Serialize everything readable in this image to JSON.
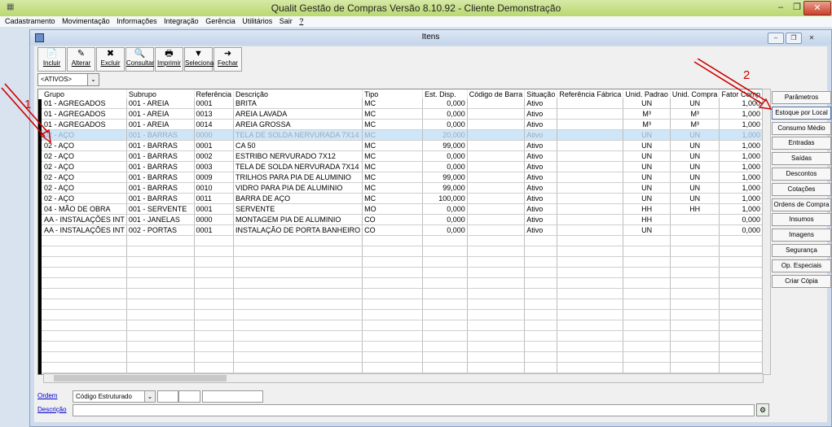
{
  "app_title": "Qualit Gestão de Compras Versão 8.10.92 - Cliente Demonstração",
  "window_buttons": {
    "minimize": "–",
    "restore": "❐",
    "close": "✕"
  },
  "menu": [
    {
      "label": "Cadastramento"
    },
    {
      "label": "Movimentação"
    },
    {
      "label": "Informações"
    },
    {
      "label": "Integração"
    },
    {
      "label": "Gerência"
    },
    {
      "label": "Utilitários"
    },
    {
      "label": "Sair"
    },
    {
      "label": "?"
    }
  ],
  "child_window": {
    "title": "Itens"
  },
  "toolbar": [
    {
      "label": "Incluir",
      "icon": "new-doc-icon",
      "glyph": "📄"
    },
    {
      "label": "Alterar",
      "icon": "edit-icon",
      "glyph": "✎"
    },
    {
      "label": "Excluir",
      "icon": "delete-icon",
      "glyph": "✖"
    },
    {
      "label": "Consultar",
      "icon": "query-icon",
      "glyph": "🔍"
    },
    {
      "label": "Imprimir",
      "icon": "print-icon",
      "glyph": "🖶"
    },
    {
      "label": "Seleciona",
      "icon": "filter-icon",
      "glyph": "▼"
    },
    {
      "label": "Fechar",
      "icon": "exit-icon",
      "glyph": "➜"
    }
  ],
  "filter": {
    "value": "<ATIVOS>"
  },
  "table": {
    "columns": [
      "Grupo",
      "Subrupo",
      "Referência",
      "Descrição",
      "Tipo",
      "Est. Disp.",
      "Código de Barra",
      "Situação",
      "Referência Fábrica",
      "Unid. Padrao",
      "Unid. Compra",
      "Fator Comp"
    ],
    "rows": [
      [
        "01 - AGREGADOS",
        "001 - AREIA",
        "0001",
        "BRITA",
        "MC",
        "0,000",
        "",
        "Ativo",
        "",
        "UN",
        "UN",
        "1,000"
      ],
      [
        "01 - AGREGADOS",
        "001 - AREIA",
        "0013",
        "AREIA LAVADA",
        "MC",
        "0,000",
        "",
        "Ativo",
        "",
        "M³",
        "M³",
        "1,000"
      ],
      [
        "01 - AGREGADOS",
        "001 - AREIA",
        "0014",
        "AREIA GROSSA",
        "MC",
        "0,000",
        "",
        "Ativo",
        "",
        "M³",
        "M³",
        "1,000"
      ],
      [
        "02 - AÇO",
        "001 - BARRAS",
        "0000",
        "TELA DE SOLDA NERVURADA 7X14",
        "MC",
        "20,000",
        "",
        "Ativo",
        "",
        "UN",
        "UN",
        "1,000"
      ],
      [
        "02 - AÇO",
        "001 - BARRAS",
        "0001",
        "CA 50",
        "MC",
        "99,000",
        "",
        "Ativo",
        "",
        "UN",
        "UN",
        "1,000"
      ],
      [
        "02 - AÇO",
        "001 - BARRAS",
        "0002",
        "ESTRIBO NERVURADO 7X12",
        "MC",
        "0,000",
        "",
        "Ativo",
        "",
        "UN",
        "UN",
        "1,000"
      ],
      [
        "02 - AÇO",
        "001 - BARRAS",
        "0003",
        "TELA DE SOLDA NERVURADA 7X14",
        "MC",
        "0,000",
        "",
        "Ativo",
        "",
        "UN",
        "UN",
        "1,000"
      ],
      [
        "02 - AÇO",
        "001 - BARRAS",
        "0009",
        "TRILHOS PARA PIA DE ALUMINIO",
        "MC",
        "99,000",
        "",
        "Ativo",
        "",
        "UN",
        "UN",
        "1,000"
      ],
      [
        "02 - AÇO",
        "001 - BARRAS",
        "0010",
        "VIDRO PARA PIA DE ALUMINIO",
        "MC",
        "99,000",
        "",
        "Ativo",
        "",
        "UN",
        "UN",
        "1,000"
      ],
      [
        "02 - AÇO",
        "001 - BARRAS",
        "0011",
        "BARRA DE AÇO",
        "MC",
        "100,000",
        "",
        "Ativo",
        "",
        "UN",
        "UN",
        "1,000"
      ],
      [
        "04 - MÃO DE OBRA",
        "001 - SERVENTE",
        "0001",
        "SERVENTE",
        "MO",
        "0,000",
        "",
        "Ativo",
        "",
        "HH",
        "HH",
        "1,000"
      ],
      [
        "AA - INSTALAÇÕES INT",
        "001 - JANELAS",
        "0000",
        "MONTAGEM PIA DE ALUMINIO",
        "CO",
        "0,000",
        "",
        "Ativo",
        "",
        "HH",
        "",
        "0,000"
      ],
      [
        "AA - INSTALAÇÕES INT",
        "002 - PORTAS",
        "0001",
        "INSTALAÇÃO DE PORTA BANHEIRO",
        "CO",
        "0,000",
        "",
        "Ativo",
        "",
        "UN",
        "",
        "0,000"
      ]
    ],
    "selected_row": 3
  },
  "side_buttons": [
    "Parâmetros",
    "Estoque por Local",
    "Consumo Médio",
    "Entradas",
    "Saídas",
    "Descontos",
    "Cotações",
    "Ordens de Compra",
    "Insumos",
    "Imagens",
    "Segurança",
    "Op. Especiais",
    "Criar Cópia"
  ],
  "bottom": {
    "ordem_label": "Ordem",
    "ordem_value": "Código Estruturado",
    "descricao_label": "Descrição",
    "descricao_value": ""
  },
  "annotations": {
    "label1": "1",
    "label2": "2",
    "color": "#cc0000"
  }
}
